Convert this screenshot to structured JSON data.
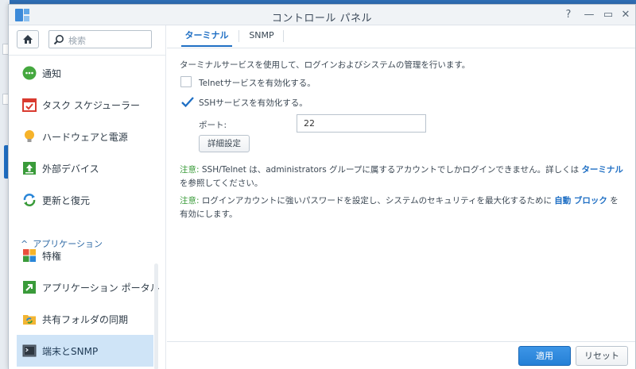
{
  "window": {
    "title": "コントロール パネル",
    "controls": {
      "help": "?",
      "minimize": "—",
      "maximize": "▭",
      "close": "✕"
    }
  },
  "sidebar": {
    "search_placeholder": "検索",
    "items": [
      {
        "label": "通知",
        "icon": "notification-icon"
      },
      {
        "label": "タスク スケジューラー",
        "icon": "task-scheduler-icon"
      },
      {
        "label": "ハードウェアと電源",
        "icon": "hardware-power-icon"
      },
      {
        "label": "外部デバイス",
        "icon": "external-devices-icon"
      },
      {
        "label": "更新と復元",
        "icon": "update-restore-icon"
      }
    ],
    "section_label": "アプリケーション",
    "app_items": [
      {
        "label": "特権",
        "icon": "privileges-icon"
      },
      {
        "label": "アプリケーション ポータル",
        "icon": "application-portal-icon"
      },
      {
        "label": "共有フォルダの同期",
        "icon": "shared-folder-sync-icon"
      },
      {
        "label": "端末とSNMP",
        "icon": "terminal-snmp-icon",
        "active": true
      }
    ]
  },
  "main": {
    "tabs": [
      {
        "label": "ターミナル",
        "active": true
      },
      {
        "label": "SNMP",
        "active": false
      }
    ],
    "description": "ターミナルサービスを使用して、ログインおよびシステムの管理を行います。",
    "telnet": {
      "label": "Telnetサービスを有効化する。",
      "checked": false
    },
    "ssh": {
      "label": "SSHサービスを有効化する。",
      "checked": true
    },
    "port": {
      "label": "ポート:",
      "value": "22"
    },
    "advanced_button": "詳細設定",
    "note1": {
      "prefix": "注意:",
      "text_before": " SSH/Telnet は、administrators グループに属するアカウントでしかログインできません。詳しくは ",
      "link": "ターミナル",
      "text_after": " を参照してください。"
    },
    "note2": {
      "prefix": "注意:",
      "text_before": " ログインアカウントに強いパスワードを設定し、システムのセキュリティを最大化するために ",
      "link": "自動 ブロック",
      "text_after": " を有効にします。"
    },
    "apply_button": "適用",
    "reset_button": "リセット"
  },
  "colors": {
    "accent": "#1f6fc4",
    "note_prefix": "#3a9b3a",
    "active_item_bg": "#cfe4f7"
  }
}
